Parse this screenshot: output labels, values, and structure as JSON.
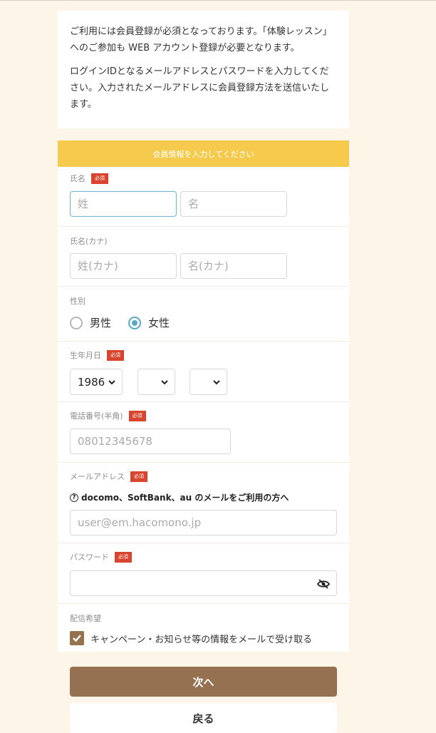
{
  "notice": {
    "line1": "ご利用には会員登録が必須となっております。「体験レッスン」へのご参加も WEB アカウント登録が必要となります。",
    "line2": "ログインIDとなるメールアドレスとパスワードを入力してください。入力されたメールアドレスに会員登録方法を送信いたします。"
  },
  "form": {
    "header": "会員情報を入力してください",
    "required_badge": "必須",
    "name": {
      "label": "氏名",
      "last_placeholder": "姓",
      "first_placeholder": "名"
    },
    "kana": {
      "label": "氏名(カナ)",
      "last_placeholder": "姓(カナ)",
      "first_placeholder": "名(カナ)"
    },
    "gender": {
      "label": "性別",
      "options": [
        "男性",
        "女性"
      ],
      "selected": "女性"
    },
    "birthday": {
      "label": "生年月日",
      "year": "1986",
      "month": "",
      "day": ""
    },
    "phone": {
      "label": "電話番号(半角)",
      "placeholder": "08012345678"
    },
    "email": {
      "label": "メールアドレス",
      "hint": "docomo、SoftBank、au のメールをご利用の方へ",
      "placeholder": "user@em.hacomono.jp"
    },
    "password": {
      "label": "パスワード",
      "value": ""
    },
    "newsletter": {
      "label": "配信希望",
      "checkbox_label": "キャンペーン・お知らせ等の情報をメールで受け取る",
      "checked": true
    }
  },
  "buttons": {
    "next": "次へ",
    "back": "戻る"
  },
  "colors": {
    "accent_yellow": "#f5ca4d",
    "brown": "#967151",
    "badge_red": "#d9442e",
    "radio_blue": "#5aa7c7"
  }
}
